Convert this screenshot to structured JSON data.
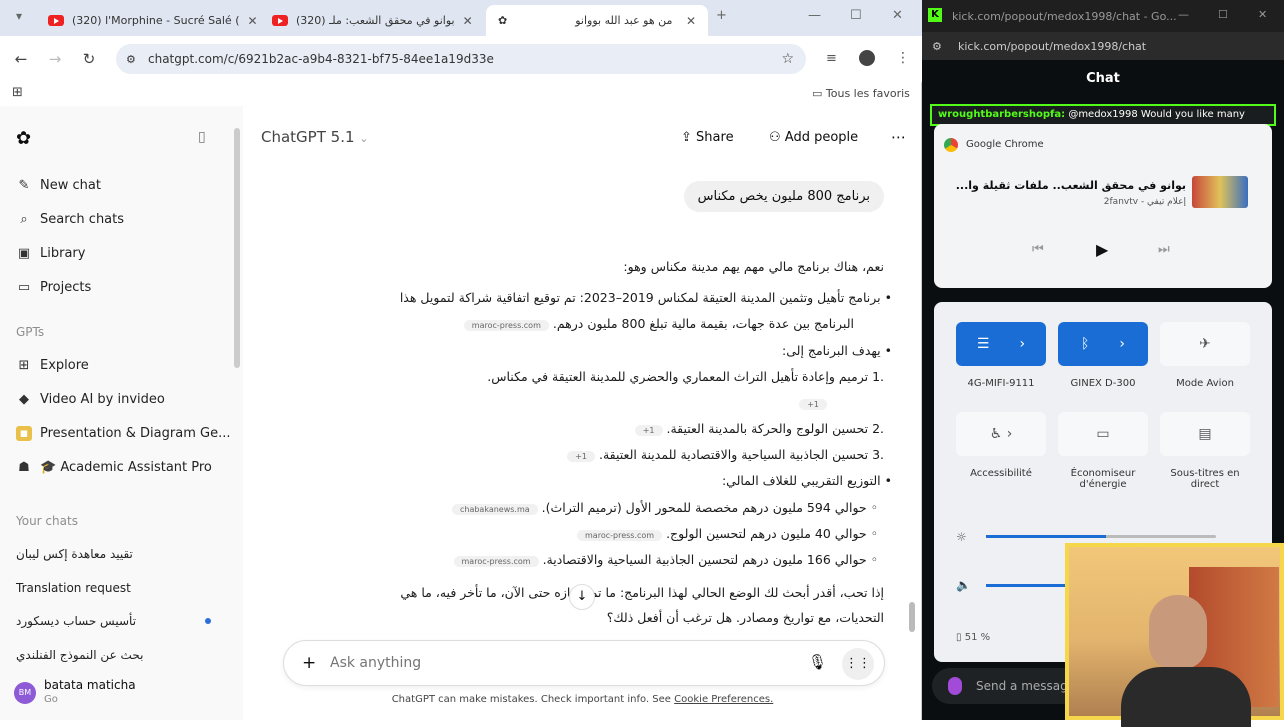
{
  "browser": {
    "tabs": [
      {
        "label": "(320) l'Morphine - Sucré Salé (",
        "type": "youtube"
      },
      {
        "label": "(320) بوانو في محقق الشعب: ملـ",
        "type": "youtube"
      },
      {
        "label": "من هو عبد الله بووانو",
        "type": "chatgpt"
      }
    ],
    "url": "chatgpt.com/c/6921b2ac-a9b4-8321-bf75-84ee1a19d33e",
    "bookmarks_label": "Tous les favoris"
  },
  "sidebar": {
    "items": [
      {
        "label": "New chat",
        "icon": "edit-icon"
      },
      {
        "label": "Search chats",
        "icon": "search-icon"
      },
      {
        "label": "Library",
        "icon": "library-icon"
      },
      {
        "label": "Projects",
        "icon": "folder-icon"
      }
    ],
    "gpts_heading": "GPTs",
    "gpts": [
      {
        "label": "Explore",
        "icon": "grid-icon"
      },
      {
        "label": "Video AI by invideo",
        "icon": "video-icon"
      },
      {
        "label": "Presentation & Diagram Ge...",
        "icon": "presentation-icon"
      },
      {
        "label": "🎓 Academic Assistant Pro",
        "icon": "academic-icon"
      }
    ],
    "chats_heading": "Your chats",
    "chats": [
      "تقييد معاهدة إكس ليبان",
      "Translation request",
      "تأسيس حساب ديسكورد",
      "بحث عن النموذج الفنلندي"
    ],
    "user": {
      "name": "batata maticha",
      "plan": "Go",
      "initials": "BM"
    }
  },
  "main": {
    "model_name": "ChatGPT 5.1",
    "share_label": "Share",
    "add_people_label": "Add people",
    "user_message": "برنامج 800 مليون يخص مكناس",
    "answer": {
      "intro": "نعم، هناك برنامج مالي مهم يهم مدينة مكناس وهو:",
      "bullet1_line1": "برنامج تأهيل وتثمين المدينة العتيقة لمكناس 2019–2023: تم توقيع اتفاقية شراكة لتمويل هذا",
      "bullet1_line2": "البرنامج بين عدة جهات، بقيمة مالية تبلغ 800 مليون درهم.",
      "bullet2": "يهدف البرنامج إلى:",
      "item1": "ترميم وإعادة تأهيل التراث المعماري والحضري للمدينة العتيقة في مكناس.",
      "item2": "تحسين الولوج والحركة بالمدينة العتيقة.",
      "item3": "تحسين الجاذبية السياحية والاقتصادية للمدينة العتيقة.",
      "bullet3": "التوزيع التقريبي للغلاف المالي:",
      "sub1": "حوالي 594 مليون درهم مخصصة للمحور الأول (ترميم التراث).",
      "sub2": "حوالي 40 مليون درهم لتحسين الولوج.",
      "sub3": "حوالي 166 مليون درهم لتحسين الجاذبية السياحية والاقتصادية.",
      "outro_line1": "إذا تحب، أقدر أبحث لك الوضع الحالي لهذا البرنامج: ما تم إنجازه حتى الآن، ما تأخر فيه، ما هي",
      "outro_line2": "التحديات، مع تواريخ ومصادر. هل ترغب أن أفعل ذلك؟"
    },
    "sources": {
      "s1": "maroc-press.com",
      "s2": "+1",
      "s3": "+1",
      "s4": "+1",
      "s5": "chabakanews.ma",
      "s6": "maroc-press.com",
      "s7": "maroc-press.com"
    },
    "composer_placeholder": "Ask anything",
    "disclaimer": "ChatGPT can make mistakes. Check important info. See",
    "cookie_link": "Cookie Preferences."
  },
  "side_window": {
    "title": "kick.com/popout/medox1998/chat - Go...",
    "url": "kick.com/popout/medox1998/chat",
    "chat_heading": "Chat",
    "pinned_user": "wroughtbarbershopfa:",
    "pinned_text": "@medox1998 Would you like many",
    "media": {
      "app": "Google Chrome",
      "title": "بوانو في محقق الشعب.. ملفات ثقيلة وا...",
      "artist": "إعلام تيفي - 2fanvtv"
    },
    "quick_settings": [
      {
        "label": "4G-MIFI-9111",
        "active": true,
        "icon": "wifi-icon"
      },
      {
        "label": "GINEX D-300",
        "active": true,
        "icon": "bluetooth-icon"
      },
      {
        "label": "Mode Avion",
        "active": false,
        "icon": "airplane-icon"
      },
      {
        "label": "Accessibilité",
        "active": false,
        "icon": "accessibility-icon"
      },
      {
        "label": "Économiseur d'énergie",
        "active": false,
        "icon": "battery-saver-icon"
      },
      {
        "label": "Sous-titres en direct",
        "active": false,
        "icon": "captions-icon"
      }
    ],
    "brightness_fraction": 0.52,
    "volume_fraction": 0.35,
    "battery": "51 %",
    "send_placeholder": "Send a message"
  }
}
